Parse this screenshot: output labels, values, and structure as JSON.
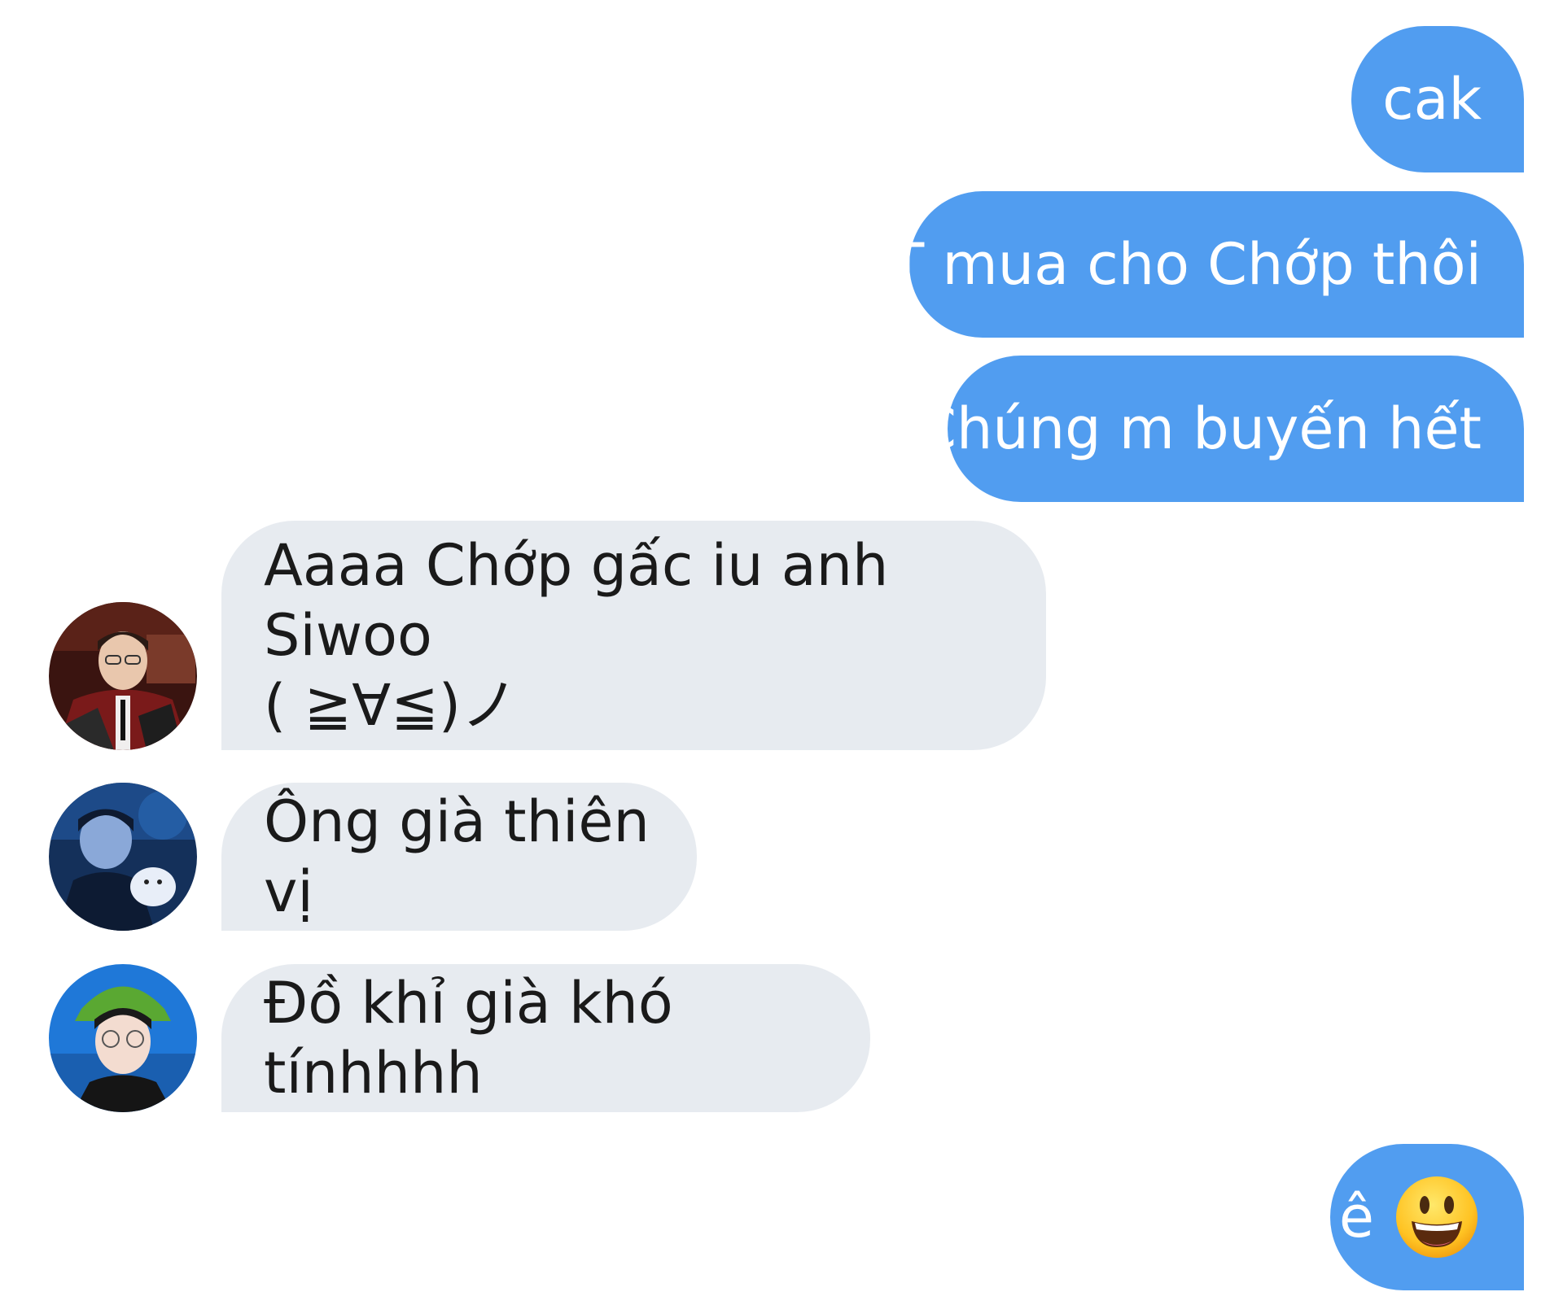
{
  "conversation": {
    "messages": [
      {
        "sender": "me",
        "text": "cak"
      },
      {
        "sender": "me",
        "text": "T mua cho Chớp thôi"
      },
      {
        "sender": "me",
        "text": "Chúng m buyến hết"
      },
      {
        "sender": "contact-1",
        "text": "Aaaa Chớp gấc iu anh Siwoo\n( ≧∀≦)ノ"
      },
      {
        "sender": "contact-2",
        "text": "Ông già thiên vị"
      },
      {
        "sender": "contact-3",
        "text": "Đồ khỉ già khó tínhhhh"
      },
      {
        "sender": "me",
        "text": "ê",
        "emoji": "grinning-face-emoji"
      }
    ]
  },
  "colors": {
    "outgoing_bubble": "#519df0",
    "incoming_bubble": "#e7ebf0",
    "outgoing_text": "#ffffff",
    "incoming_text": "#1a1a1a",
    "background": "#ffffff"
  }
}
